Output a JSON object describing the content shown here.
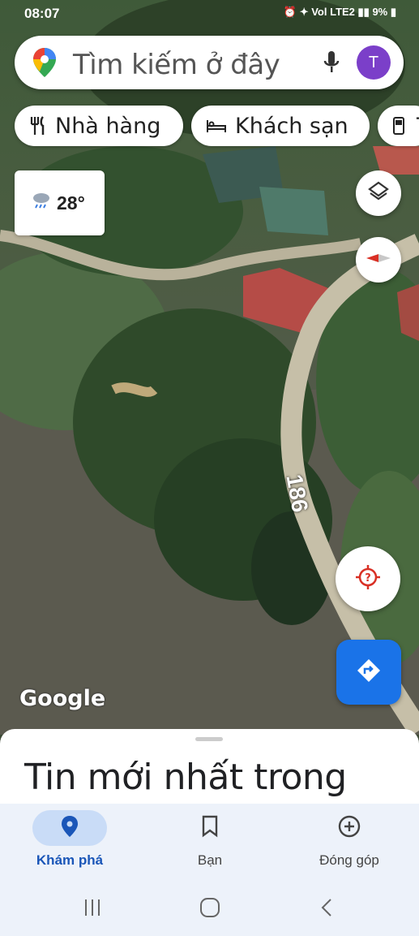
{
  "status_bar": {
    "time": "08:07",
    "right_icons": "⏰ ✦ Vol LTE2 ▮▮ 9% ▮"
  },
  "search": {
    "placeholder": "Tìm kiếm ở đây",
    "avatar_letter": "T"
  },
  "chips": [
    {
      "label": "Nhà hàng",
      "icon": "restaurant-icon"
    },
    {
      "label": "Khách sạn",
      "icon": "hotel-icon"
    },
    {
      "label": "T",
      "icon": "gas-station-icon"
    }
  ],
  "weather": {
    "temp": "28°",
    "icon": "rain-cloud-icon"
  },
  "map": {
    "road_label": "186",
    "attribution": "Google"
  },
  "sheet": {
    "title": "Tin mới nhất trong"
  },
  "bottom_nav": [
    {
      "label": "Khám phá",
      "icon": "explore-pin-icon",
      "active": true
    },
    {
      "label": "Bạn",
      "icon": "bookmark-icon",
      "active": false
    },
    {
      "label": "Đóng góp",
      "icon": "add-circle-icon",
      "active": false
    }
  ],
  "colors": {
    "accent": "#1a73e8",
    "avatar": "#7b3fc9",
    "active_pill": "#c9dcf7"
  }
}
